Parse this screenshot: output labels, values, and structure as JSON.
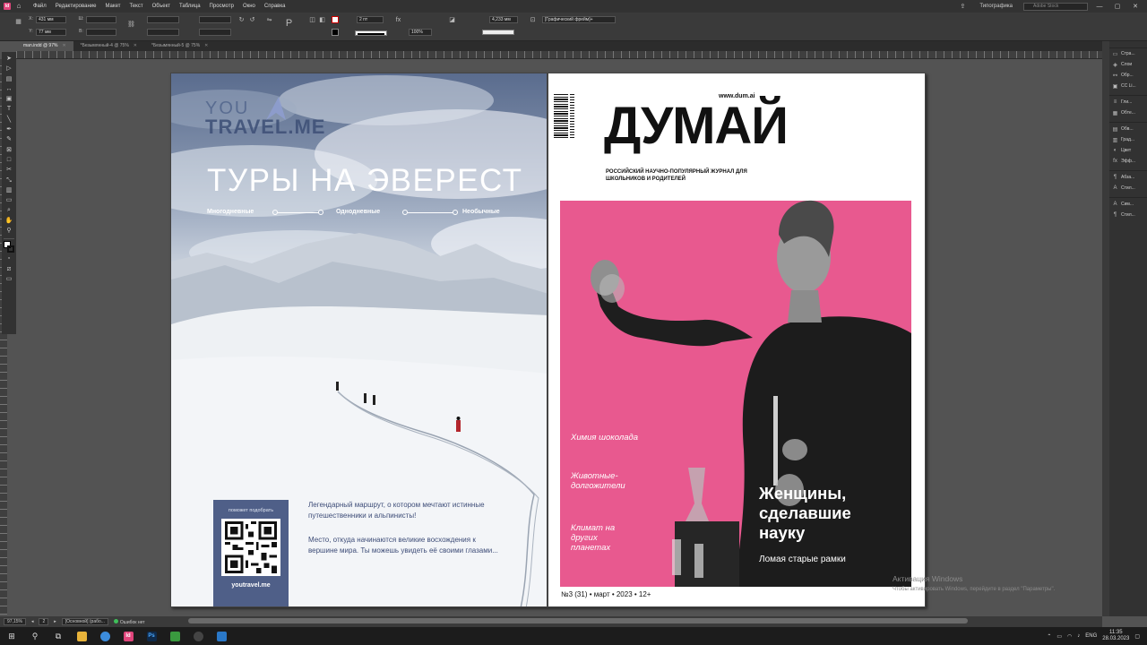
{
  "menu": {
    "items": [
      "Файл",
      "Редактирование",
      "Макет",
      "Текст",
      "Объект",
      "Таблица",
      "Просмотр",
      "Окно",
      "Справка"
    ],
    "workspace": "Типографика",
    "search_placeholder": "Adobe Stock"
  },
  "control": {
    "x_value": "431 мм",
    "y_value": "77 мм",
    "stroke_weight": "2 пт",
    "opacity": "100%",
    "dimension": "4,233 мм",
    "frame_type": "[Графический фрейм]+"
  },
  "tabs": [
    {
      "label": "man.indd @ 97%",
      "active": true
    },
    {
      "label": "*Безымянный-4 @ 75%",
      "active": false
    },
    {
      "label": "*Безымянный-5 @ 75%",
      "active": false
    }
  ],
  "right_panel": {
    "items": [
      {
        "icon": "pages-icon",
        "label": "Стра..."
      },
      {
        "icon": "layers-icon",
        "label": "Слои"
      },
      {
        "icon": "links-icon",
        "label": "Обр..."
      },
      {
        "icon": "cc-libraries-icon",
        "label": "CC Li..."
      },
      {
        "icon": "stroke-icon",
        "label": "Гли..."
      },
      {
        "icon": "wrap-icon",
        "label": "Обте..."
      },
      {
        "icon": "swatches-icon",
        "label": "Обв..."
      },
      {
        "icon": "gradient-icon",
        "label": "Град..."
      },
      {
        "icon": "color-icon",
        "label": "Цвет"
      },
      {
        "icon": "effects-icon",
        "label": "Эфф..."
      },
      {
        "icon": "paragraph-icon",
        "label": "Абза..."
      },
      {
        "icon": "char-styles-icon",
        "label": "Стил..."
      },
      {
        "icon": "character-icon",
        "label": "Сим..."
      },
      {
        "icon": "para-styles-icon",
        "label": "Стил..."
      }
    ]
  },
  "travel": {
    "logo_you": "YOU",
    "logo_travel": "TRAVEL.ME",
    "title": "ТУРЫ НА ЭВЕРЕСТ",
    "options": [
      "Многодневные",
      "Однодневные",
      "Необычные"
    ],
    "hint": "поможет подобрать",
    "url": "youtravel.me",
    "desc1": "Легендарный маршрут, о котором мечтают истинные путешественники и альпинисты!",
    "desc2": "Место, откуда начинаются великие восхождения к вершине мира. Ты можешь увидеть её своими глазами..."
  },
  "magazine": {
    "url": "www.dum.ai",
    "masthead": "ДУМАЙ",
    "tagline": "РОССИЙСКИЙ НАУЧНО-ПОПУЛЯРНЫЙ ЖУРНАЛ ДЛЯ ШКОЛЬНИКОВ И РОДИТЕЛЕЙ",
    "topics": [
      "Химия шоколада",
      "Животные- долгожители",
      "Климат на других планетах"
    ],
    "headline": "Женщины, сделавшие науку",
    "subhead": "Ломая старые рамки",
    "issue": "№3 (31) • март • 2023 • 12+"
  },
  "status": {
    "zoom": "97,15%",
    "page": "2",
    "style": "[Основной] (рабо...",
    "errors": "Ошибок нет"
  },
  "watermark": {
    "line1": "Активация Windows",
    "line2": "Чтобы активировать Windows, перейдите в раздел \"Параметры\"."
  },
  "taskbar": {
    "lang": "ENG",
    "time": "11:35",
    "date": "28.03.2023",
    "apps": [
      "explorer-icon",
      "chrome-icon",
      "indesign-icon",
      "photoshop-icon",
      "illustrator-icon",
      "obs-icon",
      "photos-icon"
    ]
  }
}
